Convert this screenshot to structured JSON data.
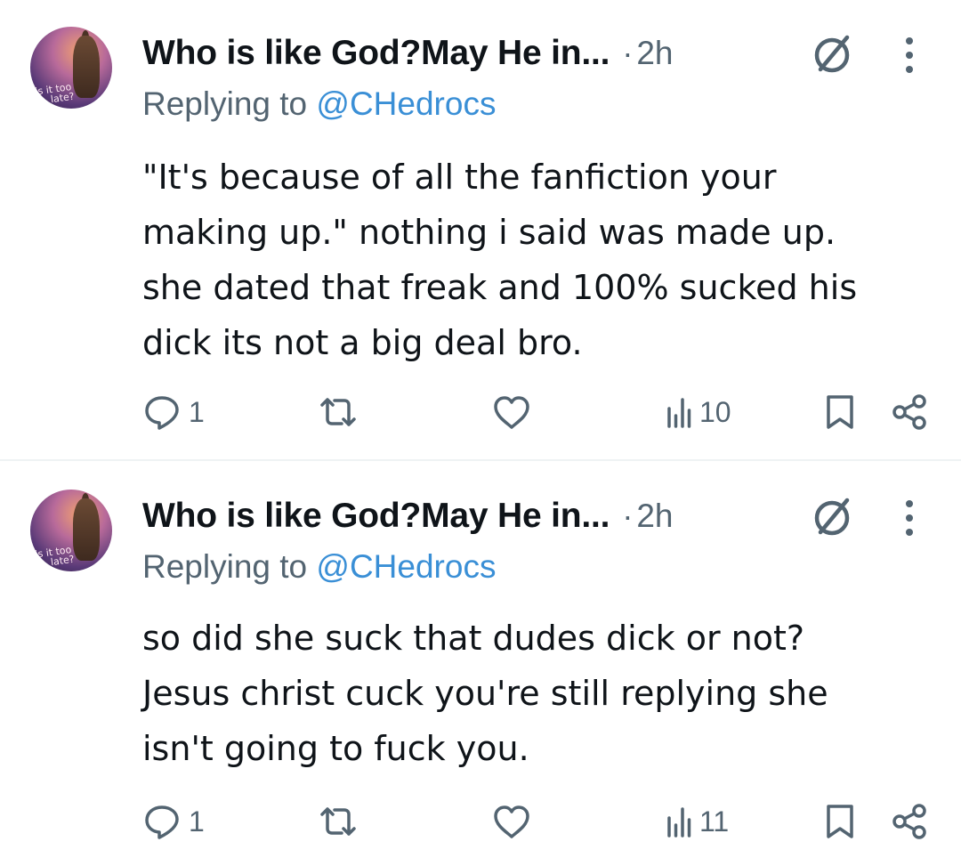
{
  "tweets": [
    {
      "display_name": "Who is like God?May He in...",
      "separator": "·",
      "time": "2h",
      "reply_prefix": "Replying to ",
      "reply_handle": "@CHedrocs",
      "avatar_text_line1": "is it too",
      "avatar_text_line2": "late?",
      "body_lines": [
        "\"It's because of all the fanfiction your",
        "making up.\" nothing i said was made up.",
        "she dated that freak and 100% sucked his",
        "dick its not a big deal bro."
      ],
      "reply_count": "1",
      "retweet_count": "",
      "like_count": "",
      "view_count": "10"
    },
    {
      "display_name": "Who is like God?May He in...",
      "separator": "·",
      "time": "2h",
      "reply_prefix": "Replying to ",
      "reply_handle": "@CHedrocs",
      "avatar_text_line1": "is it too",
      "avatar_text_line2": "late?",
      "body_lines": [
        "so did she suck that dudes dick or not?",
        "Jesus christ cuck you're still replying she",
        "isn't going to fuck you."
      ],
      "reply_count": "1",
      "retweet_count": "",
      "like_count": "",
      "view_count": "11"
    }
  ],
  "icons": {
    "avatar": "avatar-image",
    "grok": "grok-icon",
    "more": "more-vertical-icon",
    "reply": "reply-icon",
    "retweet": "retweet-icon",
    "like": "heart-icon",
    "views": "views-bar-chart-icon",
    "bookmark": "bookmark-icon",
    "share": "share-icon"
  },
  "colors": {
    "text_primary": "#0f1419",
    "text_secondary": "#536471",
    "link": "#3a8fd6",
    "divider": "#eff3f4"
  }
}
